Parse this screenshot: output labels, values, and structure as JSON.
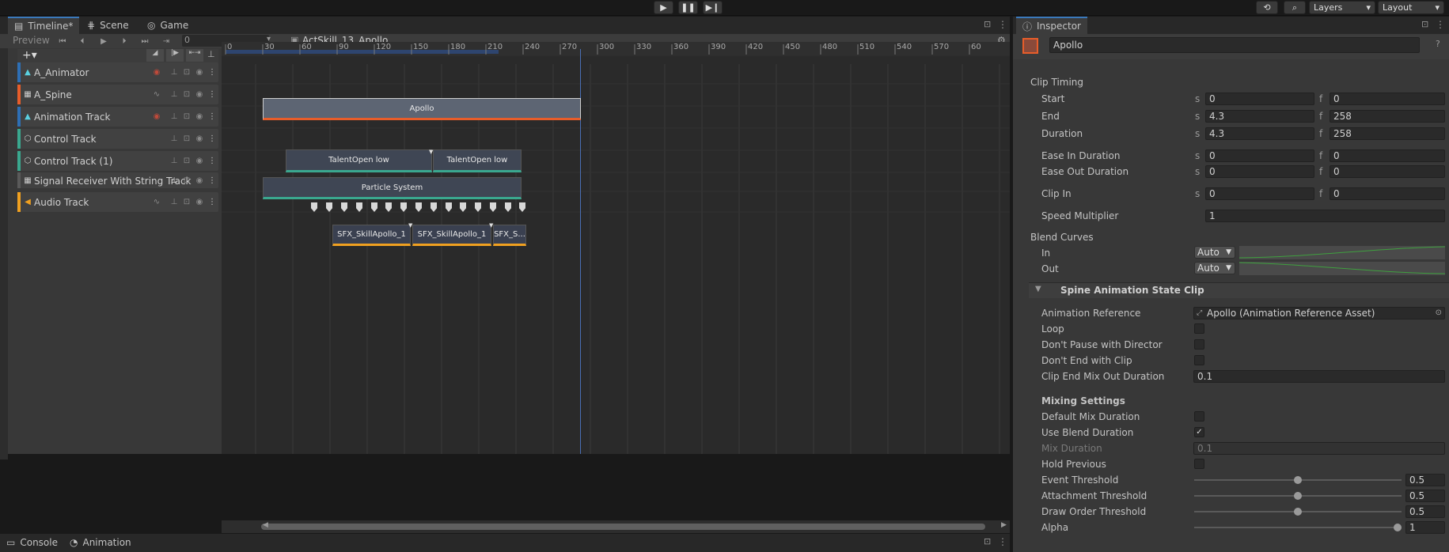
{
  "colors": {
    "accent": "#3a79bb",
    "playhead": "#4a6fb5",
    "spine_orange": "#e85d2a",
    "teal": "#3aa88f",
    "audio_orange": "#f0a020",
    "animator_blue": "#2e6fb5"
  },
  "topbar": {
    "layers_label": "Layers",
    "layout_label": "Layout"
  },
  "tabs": {
    "timeline": "Timeline*",
    "scene": "Scene",
    "game": "Game",
    "inspector": "Inspector",
    "console": "Console",
    "animation": "Animation"
  },
  "timeline": {
    "preview_label": "Preview",
    "frame_value": "0",
    "breadcrumb": "ActSkill_13_Apollo",
    "ruler_ticks": [
      "0",
      "30",
      "60",
      "90",
      "120",
      "150",
      "180",
      "210",
      "240",
      "270",
      "300",
      "330",
      "360",
      "390",
      "420",
      "450",
      "480",
      "510",
      "540",
      "570",
      "60"
    ],
    "tracks": [
      {
        "name": "A_Animator",
        "color": "#2e6fb5",
        "icon": "animator-icon"
      },
      {
        "name": "A_Spine",
        "color": "#e85d2a",
        "icon": "spine-icon"
      },
      {
        "name": "Animation Track",
        "color": "#2e6fb5",
        "icon": "animator-icon"
      },
      {
        "name": "Control Track",
        "color": "#3aa88f",
        "icon": "control-icon"
      },
      {
        "name": "Control Track (1)",
        "color": "#3aa88f",
        "icon": "control-icon"
      },
      {
        "name": "Signal Receiver With String Track",
        "color": "#5a5a5a",
        "icon": "signal-icon"
      },
      {
        "name": "Audio Track",
        "color": "#f0a020",
        "icon": "audio-icon"
      }
    ],
    "clips": {
      "spine": "Apollo",
      "control_1": "TalentOpen low",
      "control_2": "TalentOpen low",
      "particle": "Particle System",
      "audio_1": "SFX_SkillApollo_1",
      "audio_2": "SFX_SkillApollo_1",
      "audio_3": "SFX_S..."
    }
  },
  "inspector": {
    "object_name": "Apollo",
    "clip_timing_title": "Clip Timing",
    "start_label": "Start",
    "start_s": "0",
    "start_f": "0",
    "end_label": "End",
    "end_s": "4.3",
    "end_f": "258",
    "duration_label": "Duration",
    "duration_s": "4.3",
    "duration_f": "258",
    "ease_in_label": "Ease In Duration",
    "ease_in_s": "0",
    "ease_in_f": "0",
    "ease_out_label": "Ease Out Duration",
    "ease_out_s": "0",
    "ease_out_f": "0",
    "clip_in_label": "Clip In",
    "clip_in_s": "0",
    "clip_in_f": "0",
    "speed_label": "Speed Multiplier",
    "speed_value": "1",
    "blend_curves_title": "Blend Curves",
    "in_label": "In",
    "in_value": "Auto",
    "out_label": "Out",
    "out_value": "Auto",
    "spine_section_title": "Spine Animation State Clip",
    "anim_ref_label": "Animation Reference",
    "anim_ref_value": "Apollo (Animation Reference Asset)",
    "loop_label": "Loop",
    "loop_checked": false,
    "dont_pause_label": "Don't Pause with Director",
    "dont_pause_checked": false,
    "dont_end_label": "Don't End with Clip",
    "dont_end_checked": false,
    "clip_end_mix_label": "Clip End Mix Out Duration",
    "clip_end_mix_value": "0.1",
    "mixing_title": "Mixing Settings",
    "default_mix_label": "Default Mix Duration",
    "default_mix_checked": false,
    "use_blend_label": "Use Blend Duration",
    "use_blend_checked": true,
    "mix_duration_label": "Mix Duration",
    "mix_duration_value": "0.1",
    "hold_previous_label": "Hold Previous",
    "hold_previous_checked": false,
    "event_threshold_label": "Event Threshold",
    "event_threshold_value": "0.5",
    "attachment_threshold_label": "Attachment Threshold",
    "attachment_threshold_value": "0.5",
    "draw_order_threshold_label": "Draw Order Threshold",
    "draw_order_threshold_value": "0.5",
    "alpha_label": "Alpha",
    "alpha_value": "1"
  }
}
